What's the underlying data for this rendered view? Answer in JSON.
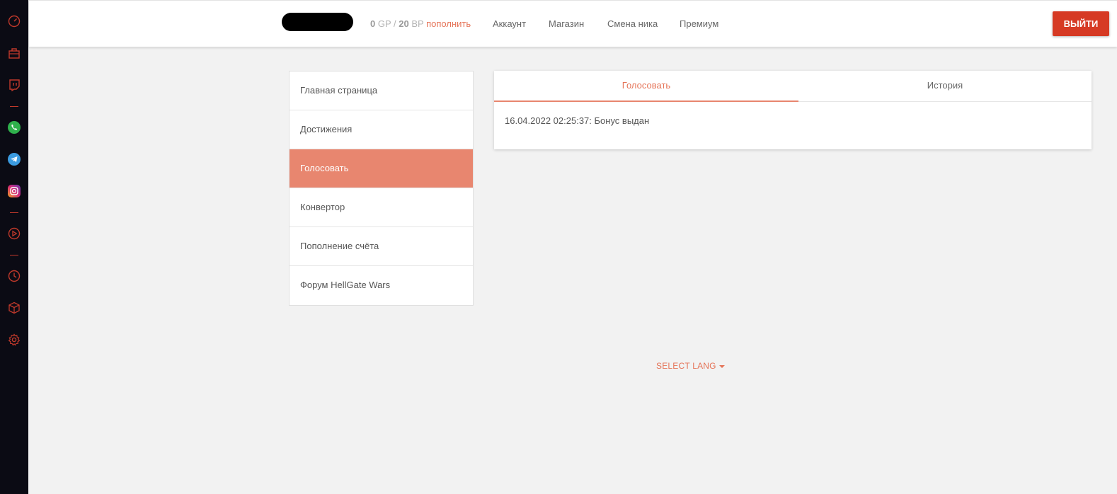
{
  "rail": {
    "icons": [
      "dashboard-icon",
      "briefcase-icon",
      "twitch-icon",
      "whatsapp-icon",
      "telegram-icon",
      "instagram-icon",
      "play-icon",
      "clock-icon",
      "cube-icon",
      "gear-icon"
    ],
    "accent": "#c0392b"
  },
  "header": {
    "balance": {
      "gp_value": "0",
      "gp_unit": "GP",
      "separator": "/",
      "bp_value": "20",
      "bp_unit": "BP",
      "topup_label": "пополнить"
    },
    "nav": [
      {
        "label": "Аккаунт"
      },
      {
        "label": "Магазин"
      },
      {
        "label": "Смена ника"
      },
      {
        "label": "Премиум"
      }
    ],
    "logout_label": "ВЫЙТИ"
  },
  "sidebar": {
    "items": [
      {
        "label": "Главная страница"
      },
      {
        "label": "Достижения"
      },
      {
        "label": "Голосовать",
        "active": true
      },
      {
        "label": "Конвертор"
      },
      {
        "label": "Пополнение счёта"
      },
      {
        "label": "Форум HellGate Wars"
      }
    ]
  },
  "panel": {
    "tabs": [
      {
        "label": "Голосовать",
        "active": true
      },
      {
        "label": "История"
      }
    ],
    "log": "16.04.2022 02:25:37: Бонус выдан"
  },
  "footer": {
    "lang_label": "SELECT LANG"
  },
  "colors": {
    "accent": "#e8866f",
    "accent_text": "#e57357",
    "logout_bg": "#d63a24",
    "rail_bg": "#0b0b14"
  }
}
